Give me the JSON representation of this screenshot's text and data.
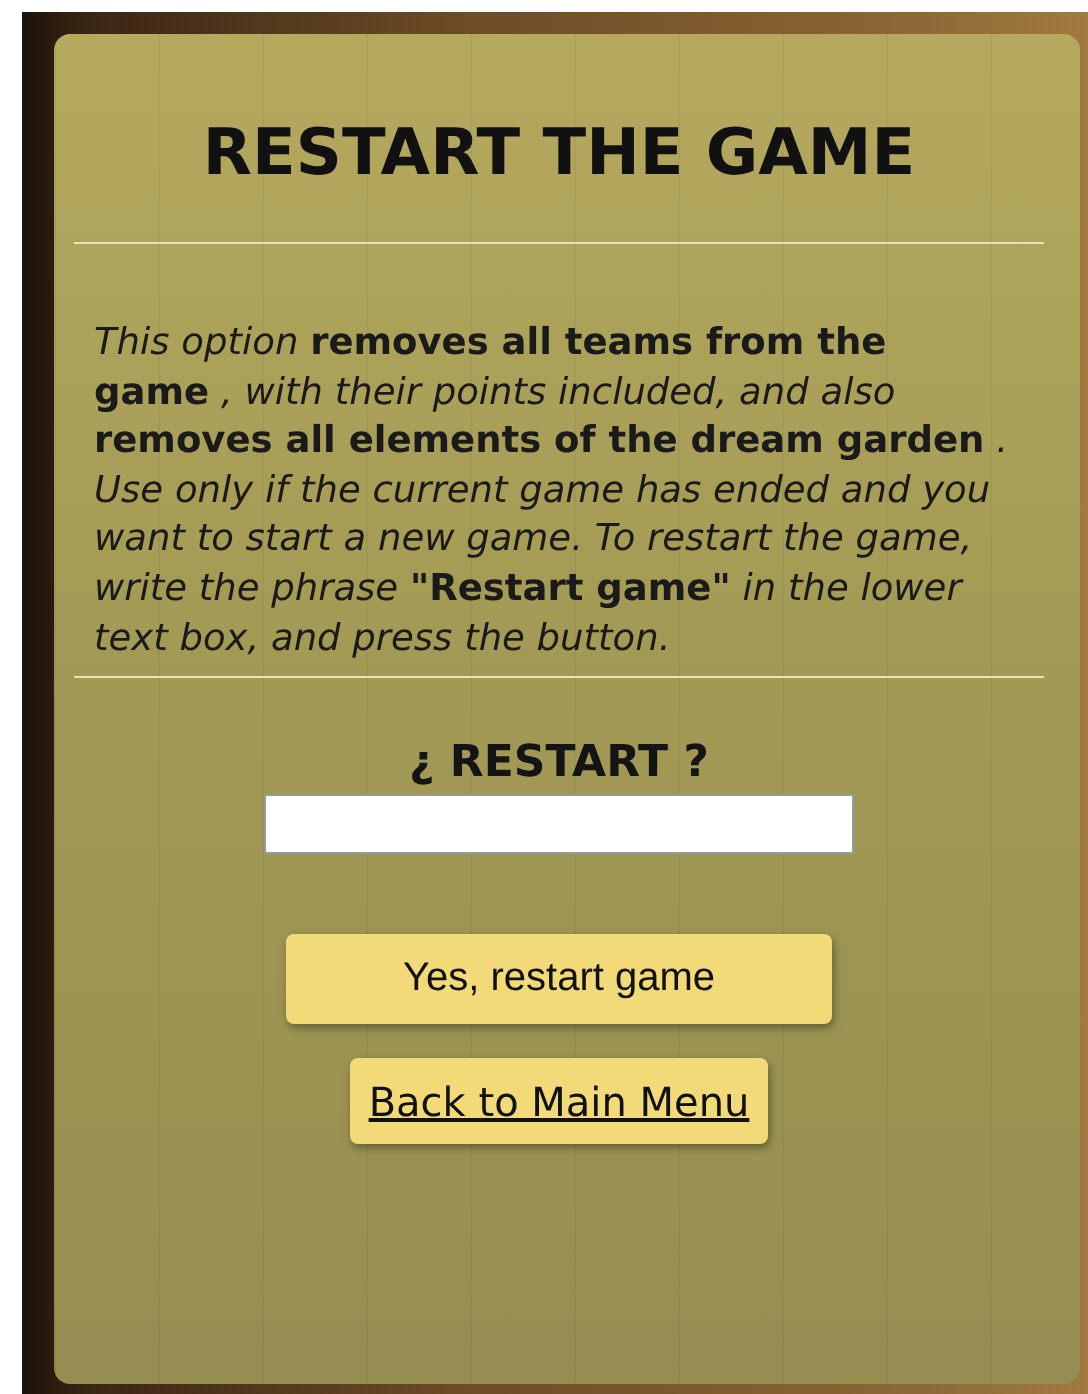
{
  "title": "RESTART THE GAME",
  "description": "*This option* **removes all teams from the game** *, with their points included, and also* **removes all elements of the dream garden** *. Use only if the current game has ended and you want to start a new game. To restart the game, write the phrase* **\"Restart game\"** *in the lower text box, and press the button.*",
  "confirm": {
    "label": "¿ RESTART ?"
  },
  "buttons": [
    {
      "kind": "primary",
      "label": "Yes, restart game"
    },
    {
      "kind": "link",
      "label": "Back to Main Menu"
    }
  ]
}
